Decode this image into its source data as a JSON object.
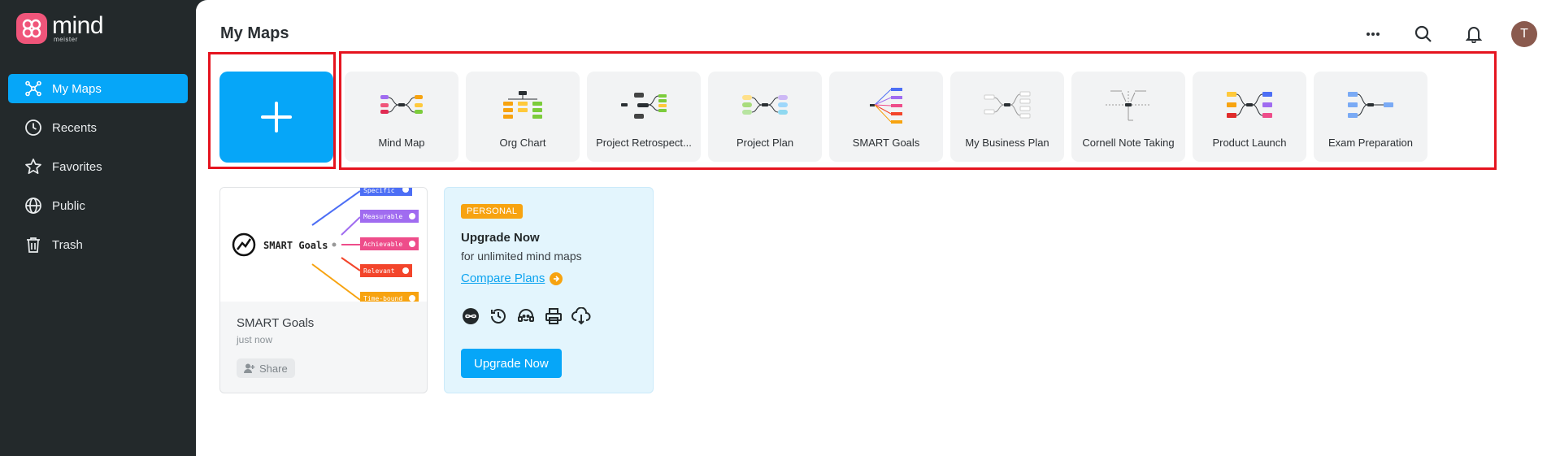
{
  "app": {
    "logo_word": "mind",
    "logo_sub": "meister"
  },
  "sidebar": {
    "items": [
      {
        "label": "My Maps",
        "icon": "mindmap-icon",
        "active": true
      },
      {
        "label": "Recents",
        "icon": "clock-icon"
      },
      {
        "label": "Favorites",
        "icon": "star-icon"
      },
      {
        "label": "Public",
        "icon": "globe-icon"
      },
      {
        "label": "Trash",
        "icon": "trash-icon"
      }
    ]
  },
  "header": {
    "title": "My Maps",
    "avatar_initial": "T",
    "icons": [
      "more-icon",
      "search-icon",
      "bell-icon"
    ]
  },
  "templates": [
    {
      "label": "Mind Map"
    },
    {
      "label": "Org Chart"
    },
    {
      "label": "Project Retrospect..."
    },
    {
      "label": "Project Plan"
    },
    {
      "label": "SMART Goals"
    },
    {
      "label": "My Business Plan"
    },
    {
      "label": "Cornell Note Taking"
    },
    {
      "label": "Product Launch"
    },
    {
      "label": "Exam Preparation"
    }
  ],
  "map_card": {
    "name": "SMART Goals",
    "time": "just now",
    "share_label": "Share",
    "thumb": {
      "root": "SMART Goals",
      "branches": [
        {
          "label": "Specific",
          "color": "#4c6ef5"
        },
        {
          "label": "Measurable",
          "color": "#a06cf0"
        },
        {
          "label": "Achievable",
          "color": "#ee4d8a"
        },
        {
          "label": "Relevant",
          "color": "#f3452b"
        },
        {
          "label": "Time-bound",
          "color": "#f7a310"
        }
      ]
    }
  },
  "upgrade": {
    "badge": "PERSONAL",
    "title": "Upgrade Now",
    "subtitle": "for unlimited mind maps",
    "link": "Compare Plans",
    "button": "Upgrade Now"
  },
  "colors": {
    "accent": "#06a6f8",
    "sidebar": "#23292b",
    "highlight": "#e5141f",
    "orange": "#f7a310"
  }
}
